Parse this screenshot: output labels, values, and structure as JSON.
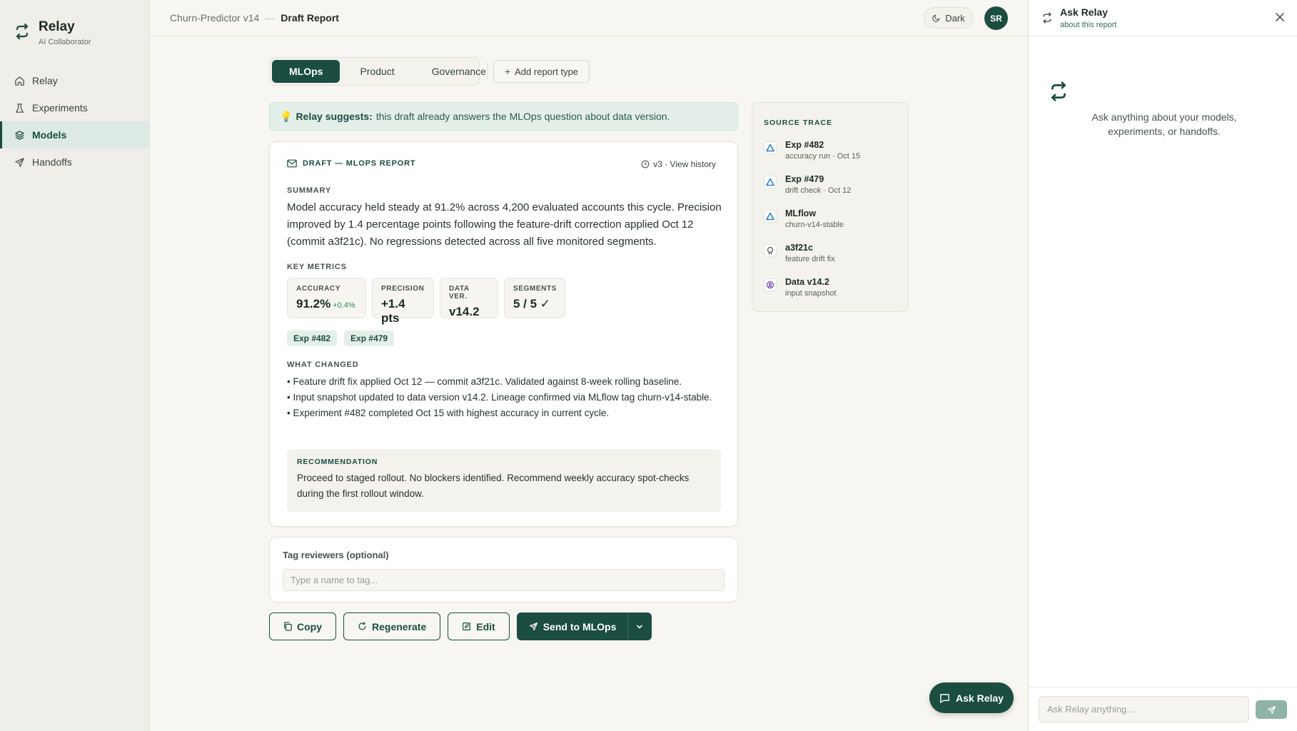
{
  "brand": {
    "title": "Relay",
    "subtitle": "AI Collaborator"
  },
  "sidebar": {
    "items": [
      {
        "label": "Relay",
        "icon": "home-icon"
      },
      {
        "label": "Experiments",
        "icon": "flask-icon"
      },
      {
        "label": "Models",
        "icon": "layers-icon",
        "active": true
      },
      {
        "label": "Handoffs",
        "icon": "send-icon"
      }
    ]
  },
  "header": {
    "breadcrumb": {
      "project": "Churn-Predictor v14",
      "separator": "—",
      "page": "Draft Report"
    },
    "theme_toggle": "Dark",
    "avatar_initials": "SR"
  },
  "report_tabs": {
    "tabs": [
      "MLOps",
      "Product",
      "Governance"
    ],
    "active": "MLOps",
    "add_label": "Add report type"
  },
  "suggestion": {
    "lead": "Relay suggests:",
    "text": "this draft already answers the MLOps question about data version."
  },
  "draft": {
    "header": "DRAFT — MLOPS REPORT",
    "history": "v3 · View history",
    "summary_label": "SUMMARY",
    "summary": "Model accuracy held steady at 91.2% across 4,200 evaluated accounts this cycle. Precision improved by 1.4 percentage points following the feature-drift correction applied Oct 12 (commit a3f21c). No regressions detected across all five monitored segments.",
    "metrics_label": "KEY METRICS",
    "metrics": [
      {
        "label": "ACCURACY",
        "value": "91.2%",
        "delta": "+0.4%"
      },
      {
        "label": "PRECISION",
        "value": "+1.4 pts"
      },
      {
        "label": "DATA VER.",
        "value": "v14.2"
      },
      {
        "label": "SEGMENTS",
        "value": "5 / 5 ✓"
      }
    ],
    "chips": [
      "Exp #482",
      "Exp #479"
    ],
    "changes_label": "WHAT CHANGED",
    "changes": [
      "• Feature drift fix applied Oct 12 — commit a3f21c. Validated against 8-week rolling baseline.",
      "• Input snapshot updated to data version v14.2. Lineage confirmed via MLflow tag churn-v14-stable.",
      "• Experiment #482 completed Oct 15 with highest accuracy in current cycle."
    ],
    "recommendation_label": "RECOMMENDATION",
    "recommendation": "Proceed to staged rollout. No blockers identified. Recommend weekly accuracy spot-checks during the first rollout window."
  },
  "reviewers": {
    "label": "Tag reviewers (optional)",
    "placeholder": "Type a name to tag..."
  },
  "actions": {
    "copy": "Copy",
    "regenerate": "Regenerate",
    "edit": "Edit",
    "send": "Send to MLOps"
  },
  "source_trace": {
    "label": "SOURCE TRACE",
    "items": [
      {
        "title": "Exp #482",
        "sub": "accuracy run · Oct 15",
        "icon": "triangle-icon"
      },
      {
        "title": "Exp #479",
        "sub": "drift check · Oct 12",
        "icon": "triangle-icon"
      },
      {
        "title": "MLflow",
        "sub": "churn-v14-stable",
        "icon": "triangle-icon"
      },
      {
        "title": "a3f21c",
        "sub": "feature drift fix",
        "icon": "git-icon"
      },
      {
        "title": "Data v14.2",
        "sub": "input snapshot",
        "icon": "database-icon"
      }
    ]
  },
  "fab_label": "Ask Relay",
  "panel": {
    "title": "Ask Relay",
    "subtitle": "about this report",
    "empty_text": "Ask anything about your models, experiments, or handoffs.",
    "input_placeholder": "Ask Relay anything..."
  },
  "colors": {
    "accent": "#1b4d40",
    "accent_light": "#e4efea",
    "positive": "#2e8b57",
    "trace_icon_blue": "#2f7fc1",
    "trace_icon_purple": "#7b4bb0"
  }
}
